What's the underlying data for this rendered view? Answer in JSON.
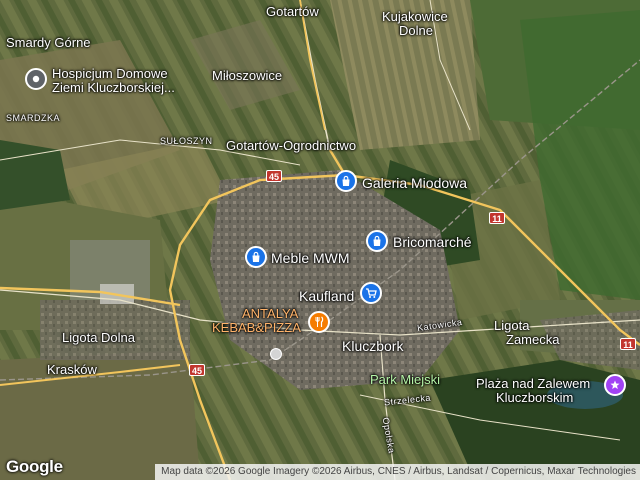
{
  "places": {
    "smardy_gorne": "Smardy Górne",
    "smardzka": "SMARDZKA",
    "suloszyn": "SUŁOSZYN",
    "gotartow": "Gotartów",
    "kujakowice_line1": "Kujakowice",
    "kujakowice_line2": "Dolne",
    "miloszowice": "Miłoszowice",
    "gotartow_ogrodnictwo": "Gotartów-Ogrodnictwo",
    "ligota_dolna": "Ligota Dolna",
    "kraskow": "Krasków",
    "kluczbork": "Kluczbork",
    "ligota_zamecka_line1": "Ligota",
    "ligota_zamecka_line2": "Zamecka",
    "park_miejski": "Park Miejski"
  },
  "streets": {
    "katowicka": "Katowicka",
    "strzelecka": "Strzelecka",
    "opolska": "Opolska"
  },
  "roads": {
    "r45_north": "45",
    "r45_south": "45",
    "r11_east": "11",
    "r11_south": "11"
  },
  "pois": {
    "hospicjum_line1": "Hospicjum Domowe",
    "hospicjum_line2": "Ziemi Kluczborskiej...",
    "galeria": "Galeria Miodowa",
    "bricomarche": "Bricomarché",
    "meble": "Meble MWM",
    "kaufland": "Kaufland",
    "antalya_line1": "ANTALYA",
    "antalya_line2": "KEBAB&PIZZA",
    "plaza_line1": "Plaża nad Zalewem",
    "plaza_line2": "Kluczborskim"
  },
  "icons": {
    "hospicjum": "place-pin-icon",
    "galeria": "shopping-bag-icon",
    "bricomarche": "shopping-bag-icon",
    "meble": "shopping-bag-icon",
    "kaufland": "shopping-cart-icon",
    "antalya": "restaurant-icon",
    "plaza": "attraction-icon",
    "station": "train-station-icon"
  },
  "colors": {
    "shop_pin": "#1a73e8",
    "place_pin": "#5f6368",
    "restaurant_pin": "#f57c00",
    "attraction_pin": "#a142f4",
    "road_shield": "#c2362e",
    "road_line": "#f2c55c"
  },
  "footer": {
    "logo": "Google",
    "attribution": "Map data ©2026 Google Imagery ©2026 Airbus, CNES / Airbus, Landsat / Copernicus, Maxar Technologies"
  }
}
